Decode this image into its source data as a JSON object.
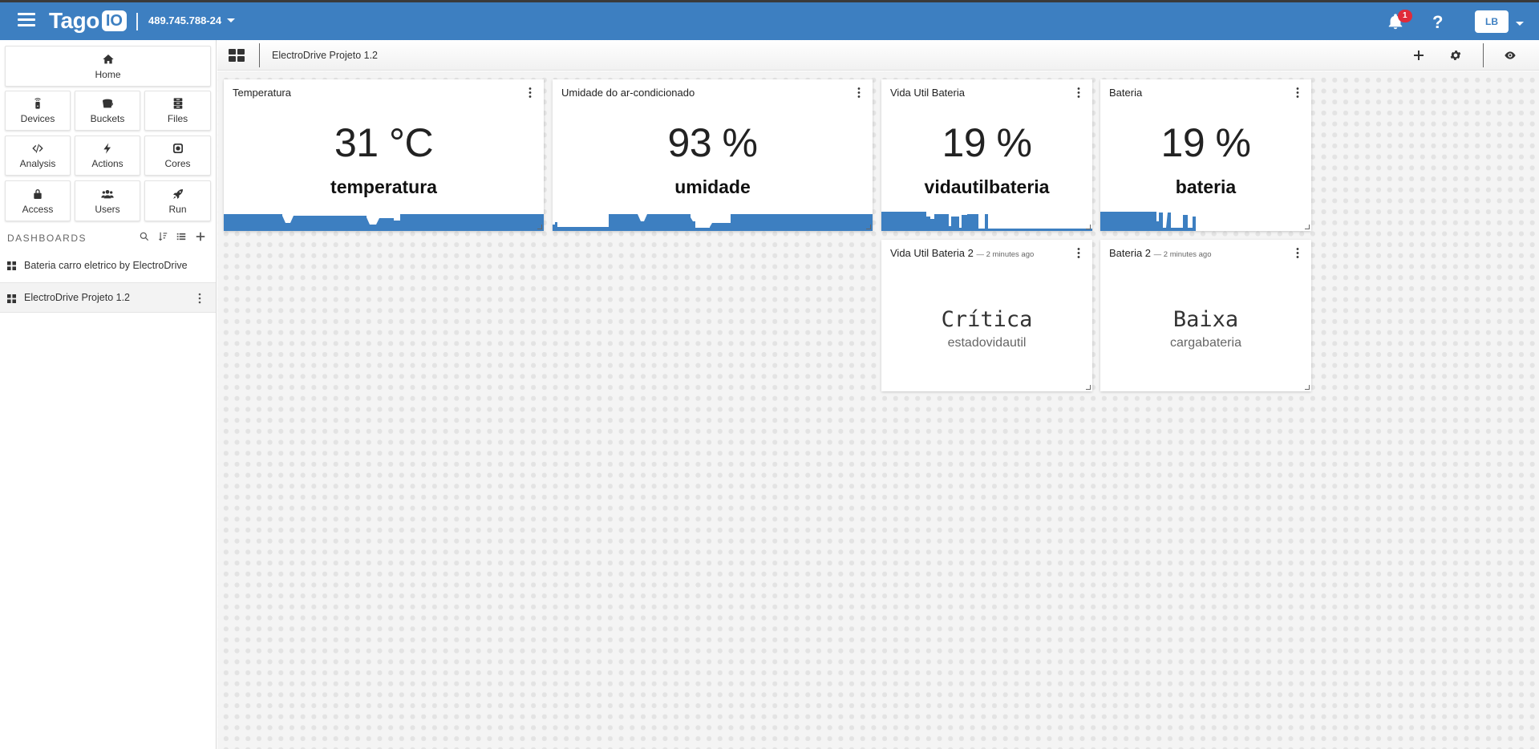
{
  "topbar": {
    "logo_text": "Tago",
    "logo_badge": "IO",
    "account": "489.745.788-24",
    "notification_count": "1",
    "help_glyph": "?",
    "user_initials": "LB"
  },
  "sidebar": {
    "nav": [
      {
        "label": "Home",
        "icon": "home-icon"
      },
      {
        "label": "Devices",
        "icon": "device-icon"
      },
      {
        "label": "Buckets",
        "icon": "bucket-icon"
      },
      {
        "label": "Files",
        "icon": "files-icon"
      },
      {
        "label": "Analysis",
        "icon": "code-icon"
      },
      {
        "label": "Actions",
        "icon": "bolt-icon"
      },
      {
        "label": "Cores",
        "icon": "chip-icon"
      },
      {
        "label": "Access",
        "icon": "lock-icon"
      },
      {
        "label": "Users",
        "icon": "users-icon"
      },
      {
        "label": "Run",
        "icon": "rocket-icon"
      }
    ],
    "dashboards_header": "DASHBOARDS",
    "dashboards": [
      {
        "name": "Bateria carro eletrico by ElectroDrive",
        "active": false
      },
      {
        "name": "ElectroDrive Projeto 1.2",
        "active": true
      }
    ]
  },
  "subbar": {
    "title": "ElectroDrive Projeto 1.2"
  },
  "widgets": [
    {
      "title": "Temperatura",
      "value": "31 °C",
      "variable": "temperatura",
      "type": "display"
    },
    {
      "title": "Umidade do ar-condicionado",
      "value": "93 %",
      "variable": "umidade",
      "type": "display"
    },
    {
      "title": "Vida Util Bateria",
      "value": "19 %",
      "variable": "vidautilbateria",
      "type": "display"
    },
    {
      "title": "Bateria",
      "value": "19 %",
      "variable": "bateria",
      "type": "display"
    },
    {
      "title": "Vida Util Bateria 2",
      "subtitle": "— 2 minutes ago",
      "value": "Crítica",
      "variable": "estadovidautil",
      "type": "text"
    },
    {
      "title": "Bateria 2",
      "subtitle": "— 2 minutes ago",
      "value": "Baixa",
      "variable": "cargabateria",
      "type": "text"
    }
  ],
  "colors": {
    "brand_blue": "#3d7fc1",
    "badge_red": "#e02b3a",
    "sparkline_blue": "#3d7fc1"
  }
}
